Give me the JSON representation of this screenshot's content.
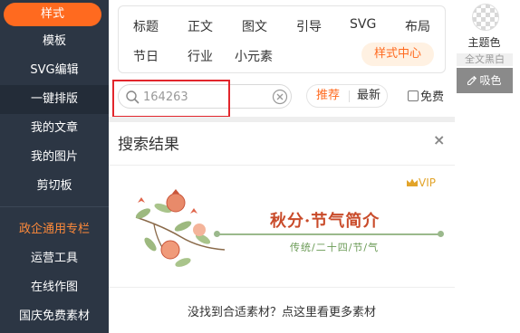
{
  "sidebar": {
    "items": [
      {
        "label": "样式"
      },
      {
        "label": "模板"
      },
      {
        "label": "SVG编辑"
      },
      {
        "label": "一键排版"
      },
      {
        "label": "我的文章"
      },
      {
        "label": "我的图片"
      },
      {
        "label": "剪切板"
      },
      {
        "label": "政企通用专栏"
      },
      {
        "label": "运营工具"
      },
      {
        "label": "在线作图"
      },
      {
        "label": "国庆免费素材"
      }
    ]
  },
  "categories": {
    "row1": [
      "标题",
      "正文",
      "图文",
      "引导",
      "SVG",
      "布局"
    ],
    "row2": [
      "节日",
      "行业",
      "小元素"
    ],
    "style_center": "样式中心"
  },
  "search": {
    "value": "164263"
  },
  "sort": {
    "recommend": "推荐",
    "latest": "最新"
  },
  "filter": {
    "free_label": "免费"
  },
  "results": {
    "title": "搜索结果",
    "close": "×",
    "card": {
      "vip": "VIP",
      "title": "秋分·节气简介",
      "subtitle": "传统/二十四/节/气"
    },
    "more_text": "没找到合适素材？点这里看更多素材"
  },
  "right_panel": {
    "theme_label": "主题色",
    "all_black": "全文黑白",
    "pick_label": "吸色"
  },
  "colors": {
    "sidebar_bg": "#2c3644",
    "accent": "#ff6a1f",
    "highlight": "#e2262c",
    "vip": "#e2a42a",
    "card_title": "#c94b2a",
    "card_sub": "#6a9a55"
  },
  "icons": {
    "search": "search-icon",
    "clear": "clear-icon",
    "close": "close-icon",
    "vip": "crown-icon",
    "pick": "eyedropper-icon"
  }
}
